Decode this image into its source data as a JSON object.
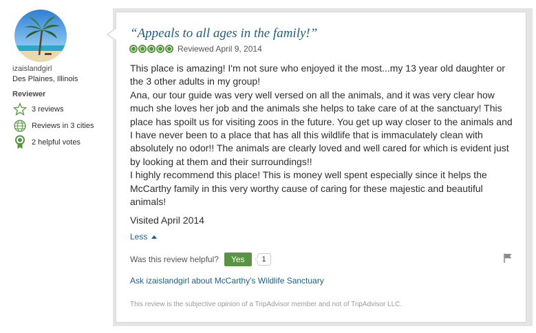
{
  "reviewer": {
    "username": "izaislandgirl",
    "location": "Des Plaines, Illinois",
    "heading": "Reviewer",
    "stats": [
      {
        "icon": "star-outline-icon",
        "label": "3 reviews"
      },
      {
        "icon": "globe-icon",
        "label": "Reviews in 3 cities"
      },
      {
        "icon": "award-ribbon-icon",
        "label": "2 helpful votes"
      }
    ]
  },
  "review": {
    "title": "“Appeals to all ages in the family!”",
    "rating_bubbles": 5,
    "reviewed_date": "Reviewed April 9, 2014",
    "paragraphs": [
      "This place is amazing! I'm not sure who enjoyed it the most...my 13 year old daughter or the 3 other adults in my group!",
      "Ana, our tour guide was very well versed on all the animals, and it was very clear how much she loves her job and the animals she helps to take care of at the sanctuary! This place has spoilt us for visiting zoos in the future. You get up way closer to the animals and I have never been to a place that has all this wildlife that is immaculately clean with absolutely no odor!! The animals are clearly loved and well cared for which is evident just by looking at them and their surroundings!!",
      "I highly recommend this place! This is money well spent especially since it helps the McCarthy family in this very worthy cause of caring for these majestic and beautiful animals!"
    ],
    "visited": "Visited April 2014",
    "less_label": "Less",
    "helpful_question": "Was this review helpful?",
    "yes_label": "Yes",
    "helpful_count": "1",
    "ask_link": "Ask izaislandgirl about McCarthy's Wildlife Sanctuary",
    "disclaimer": "This review is the subjective opinion of a TripAdvisor member and not of TripAdvisor LLC."
  },
  "colors": {
    "link": "#1a5f86",
    "bubble_green": "#589442",
    "yes_button": "#589442"
  }
}
